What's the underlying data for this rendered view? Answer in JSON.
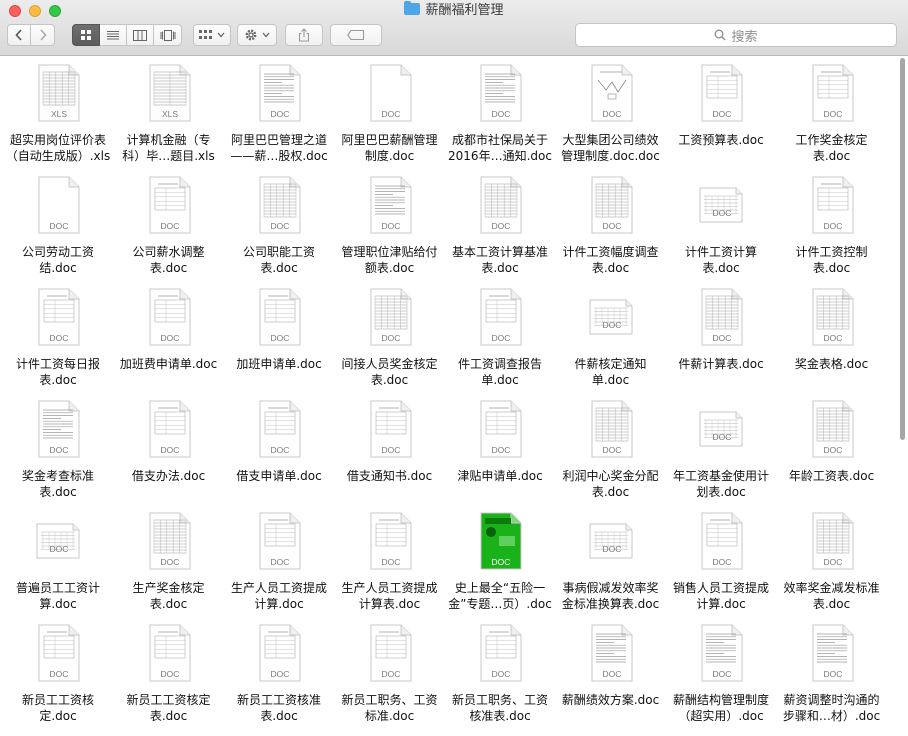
{
  "window": {
    "title": "薪酬福利管理",
    "search_placeholder": "搜索"
  },
  "colors": {
    "accent_folder": "#4ea6e8",
    "green_cover": "#19b219"
  },
  "files": [
    {
      "label": "超实用岗位评价表\n（自动生成版）.xls",
      "badge": "XLS",
      "style": "sheet"
    },
    {
      "label": "计算机金融（专\n科）毕…题目.xls",
      "badge": "XLS",
      "style": "list"
    },
    {
      "label": "阿里巴巴管理之道\n——薪…股权.doc",
      "badge": "DOC",
      "style": "text"
    },
    {
      "label": "阿里巴巴薪酬管理\n制度.doc",
      "badge": "DOC",
      "style": "blank"
    },
    {
      "label": "成都市社保局关于\n2016年…通知.doc",
      "badge": "DOC",
      "style": "text"
    },
    {
      "label": "大型集团公司绩效\n管理制度.doc.doc",
      "badge": "DOC",
      "style": "chart"
    },
    {
      "label": "工资预算表.doc",
      "badge": "DOC",
      "style": "form"
    },
    {
      "label": "工作奖金核定\n表.doc",
      "badge": "DOC",
      "style": "form"
    },
    {
      "label": "公司劳动工资\n结.doc",
      "badge": "DOC",
      "style": "blank"
    },
    {
      "label": "公司薪水调整\n表.doc",
      "badge": "DOC",
      "style": "form"
    },
    {
      "label": "公司职能工资\n表.doc",
      "badge": "DOC",
      "style": "table"
    },
    {
      "label": "管理职位津贴给付\n额表.doc",
      "badge": "DOC",
      "style": "text"
    },
    {
      "label": "基本工资计算基准\n表.doc",
      "badge": "DOC",
      "style": "table"
    },
    {
      "label": "计件工资幅度调查\n表.doc",
      "badge": "DOC",
      "style": "table"
    },
    {
      "label": "计件工资计算\n表.doc",
      "badge": "DOC",
      "style": "landscape"
    },
    {
      "label": "计件工资控制\n表.doc",
      "badge": "DOC",
      "style": "form"
    },
    {
      "label": "计件工资每日报\n表.doc",
      "badge": "DOC",
      "style": "form"
    },
    {
      "label": "加班费申请单.doc",
      "badge": "DOC",
      "style": "form"
    },
    {
      "label": "加班申请单.doc",
      "badge": "DOC",
      "style": "form"
    },
    {
      "label": "间接人员奖金核定\n表.doc",
      "badge": "DOC",
      "style": "table"
    },
    {
      "label": "件工资调查报告\n单.doc",
      "badge": "DOC",
      "style": "form"
    },
    {
      "label": "件薪核定通知\n单.doc",
      "badge": "DOC",
      "style": "landscape"
    },
    {
      "label": "件薪计算表.doc",
      "badge": "DOC",
      "style": "table"
    },
    {
      "label": "奖金表格.doc",
      "badge": "DOC",
      "style": "table"
    },
    {
      "label": "奖金考查标准\n表.doc",
      "badge": "DOC",
      "style": "text"
    },
    {
      "label": "借支办法.doc",
      "badge": "DOC",
      "style": "form"
    },
    {
      "label": "借支申请单.doc",
      "badge": "DOC",
      "style": "form"
    },
    {
      "label": "借支通知书.doc",
      "badge": "DOC",
      "style": "form"
    },
    {
      "label": "津贴申请单.doc",
      "badge": "DOC",
      "style": "form"
    },
    {
      "label": "利润中心奖金分配\n表.doc",
      "badge": "DOC",
      "style": "table"
    },
    {
      "label": "年工资基金使用计\n划表.doc",
      "badge": "DOC",
      "style": "landscape"
    },
    {
      "label": "年龄工资表.doc",
      "badge": "DOC",
      "style": "table"
    },
    {
      "label": "普遍员工工资计\n算.doc",
      "badge": "DOC",
      "style": "landscape"
    },
    {
      "label": "生产奖金核定\n表.doc",
      "badge": "DOC",
      "style": "table"
    },
    {
      "label": "生产人员工资提成\n计算.doc",
      "badge": "DOC",
      "style": "form"
    },
    {
      "label": "生产人员工资提成\n计算表.doc",
      "badge": "DOC",
      "style": "form"
    },
    {
      "label": "史上最全“五险一\n金”专题…页）.doc",
      "badge": "DOC",
      "style": "green"
    },
    {
      "label": "事病假减发效率奖\n金标准换算表.doc",
      "badge": "DOC",
      "style": "landscape"
    },
    {
      "label": "销售人员工资提成\n计算.doc",
      "badge": "DOC",
      "style": "form"
    },
    {
      "label": "效率奖金减发标准\n表.doc",
      "badge": "DOC",
      "style": "table"
    },
    {
      "label": "新员工工资核\n定.doc",
      "badge": "DOC",
      "style": "form"
    },
    {
      "label": "新员工工资核定\n表.doc",
      "badge": "DOC",
      "style": "form"
    },
    {
      "label": "新员工工资核准\n表.doc",
      "badge": "DOC",
      "style": "form"
    },
    {
      "label": "新员工职务、工资\n标准.doc",
      "badge": "DOC",
      "style": "form"
    },
    {
      "label": "新员工职务、工资\n核准表.doc",
      "badge": "DOC",
      "style": "form"
    },
    {
      "label": "薪酬绩效方案.doc",
      "badge": "DOC",
      "style": "text"
    },
    {
      "label": "薪酬结构管理制度\n（超实用）.doc",
      "badge": "DOC",
      "style": "text"
    },
    {
      "label": "薪资调整时沟通的\n步骤和…材）.doc",
      "badge": "DOC",
      "style": "text"
    }
  ]
}
